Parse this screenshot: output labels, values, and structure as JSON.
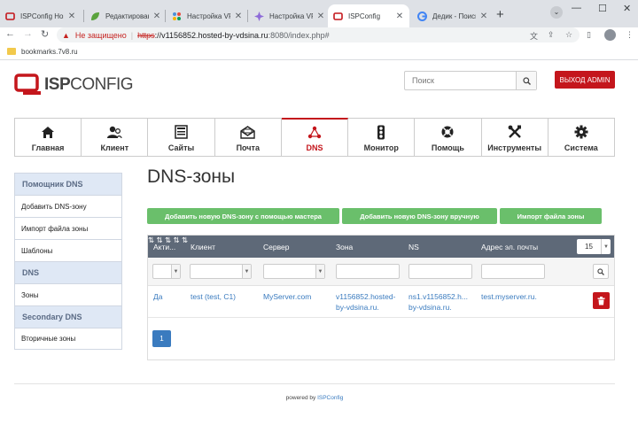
{
  "browser": {
    "tabs": [
      {
        "title": "ISPConfig Host",
        "favicon_color": "#c4161c",
        "active": false
      },
      {
        "title": "Редактирован",
        "favicon_color": "#5aa33d",
        "active": false
      },
      {
        "title": "Настройка VP",
        "favicon_color": "#4a90d9",
        "active": false
      },
      {
        "title": "Настройка VP",
        "favicon_color": "#8e6bd8",
        "active": false
      },
      {
        "title": "ISPConfig",
        "favicon_color": "#c4161c",
        "active": true
      },
      {
        "title": "Дедик - Поиск",
        "favicon_color": "#4285f4",
        "active": false
      }
    ],
    "new_tab_icon": "plus-icon",
    "window_controls": [
      "minimize-icon",
      "maximize-icon",
      "close-icon"
    ],
    "address": {
      "security_label": "Не защищено",
      "scheme": "https",
      "host": "://v1156852.hosted-by-vdsina.ru",
      "path": ":8080/index.php#"
    },
    "bookmark": "bookmarks.7v8.ru"
  },
  "header": {
    "logo_isp": "ISP",
    "logo_config": "CONFIG",
    "search_placeholder": "Поиск",
    "logout_label": "ВЫХОД ADMIN"
  },
  "nav": [
    {
      "label": "Главная",
      "icon": "home-icon",
      "active": false
    },
    {
      "label": "Клиент",
      "icon": "users-icon",
      "active": false
    },
    {
      "label": "Сайты",
      "icon": "sites-icon",
      "active": false
    },
    {
      "label": "Почта",
      "icon": "mail-icon",
      "active": false
    },
    {
      "label": "DNS",
      "icon": "dns-icon",
      "active": true
    },
    {
      "label": "Монитор",
      "icon": "traffic-light-icon",
      "active": false
    },
    {
      "label": "Помощь",
      "icon": "lifebuoy-icon",
      "active": false
    },
    {
      "label": "Инструменты",
      "icon": "tools-icon",
      "active": false
    },
    {
      "label": "Система",
      "icon": "gear-icon",
      "active": false
    }
  ],
  "sidebar": {
    "sections": [
      {
        "title": "Помощник DNS",
        "items": [
          "Добавить DNS-зону",
          "Импорт файла зоны",
          "Шаблоны"
        ]
      },
      {
        "title": "DNS",
        "items": [
          "Зоны"
        ]
      },
      {
        "title": "Secondary DNS",
        "items": [
          "Вторичные зоны"
        ]
      }
    ]
  },
  "main": {
    "title": "DNS-зоны",
    "buttons": [
      "Добавить новую DNS-зону с помощью мастера",
      "Добавить новую DNS-зону вручную",
      "Импорт файла зоны"
    ],
    "table": {
      "columns": [
        "Акти...",
        "Клиент",
        "Сервер",
        "Зона",
        "NS",
        "Адрес эл. почты"
      ],
      "page_size": "15",
      "rows": [
        {
          "active": "Да",
          "client": "test (test, C1)",
          "server": "MyServer.com",
          "zone_line1": "v1156852.hosted-",
          "zone_line2": "by-vdsina.ru.",
          "ns_line1": "ns1.v1156852.h...",
          "ns_line2": "by-vdsina.ru.",
          "email": "test.myserver.ru."
        }
      ],
      "current_page": "1"
    }
  },
  "footer": {
    "powered_by": "powered by",
    "link": "ISPConfig"
  },
  "colors": {
    "brand_red": "#c4161c",
    "button_green": "#6abf6b",
    "table_header": "#5e6978",
    "link_blue": "#3a7bbf"
  }
}
